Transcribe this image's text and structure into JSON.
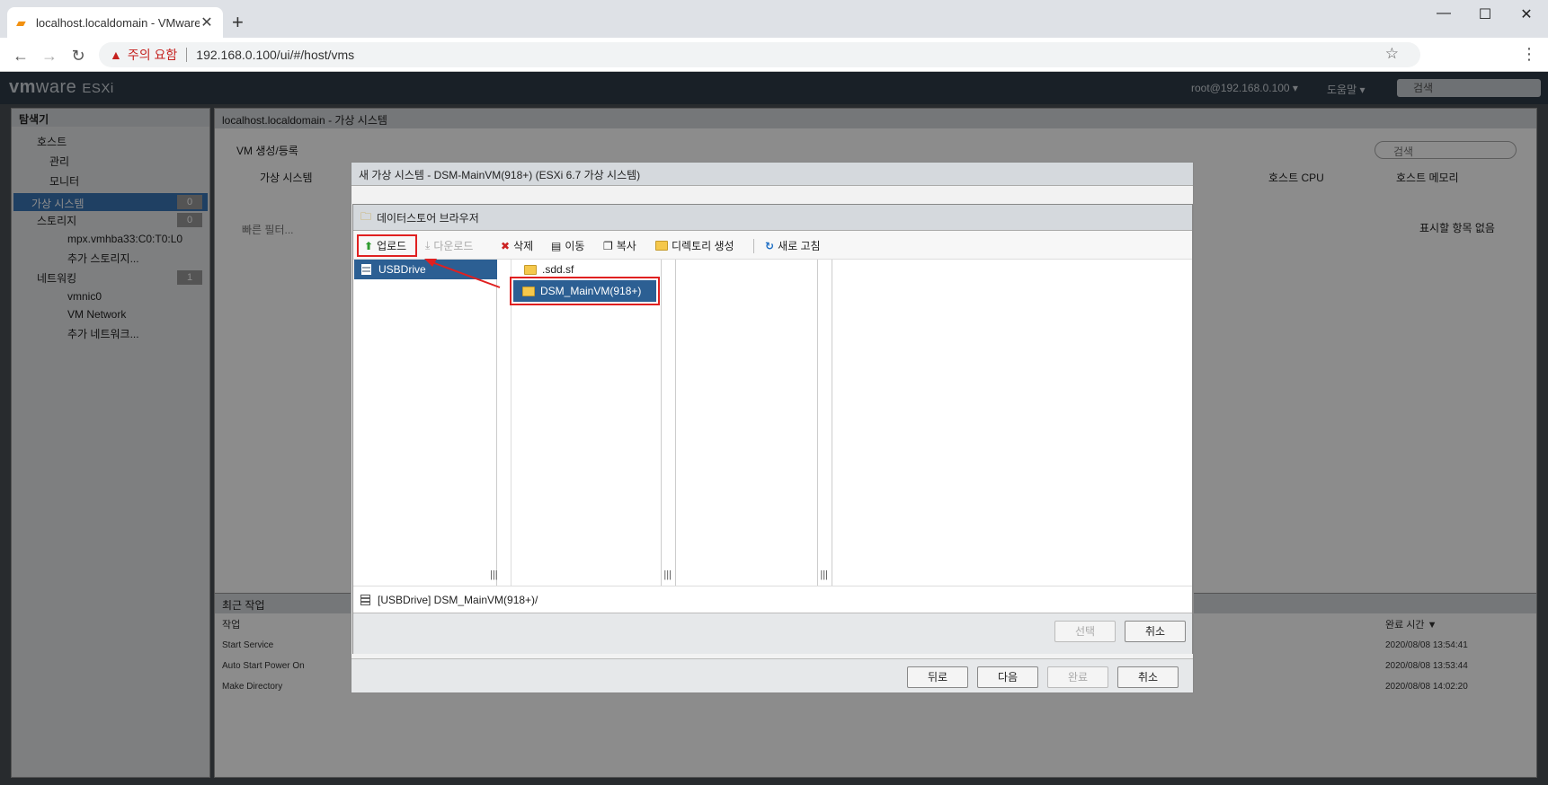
{
  "browser": {
    "tab_title": "localhost.localdomain - VMware",
    "new_tab": "+",
    "warning_label": "주의 요함",
    "url": "192.168.0.100/ui/#/host/vms"
  },
  "esxi": {
    "logo_vm": "vm",
    "logo_ware": "ware",
    "logo_product": "ESXi",
    "user": "root@192.168.0.100 ▾",
    "help": "도움말 ▾",
    "search_placeholder": "검색",
    "navigator": {
      "title": "탐색기",
      "host": "호스트",
      "manage": "관리",
      "monitor": "모니터",
      "vms": "가상 시스템",
      "vms_count": "0",
      "storage": "스토리지",
      "storage_count": "0",
      "storage_device": "mpx.vmhba33:C0:T0:L0",
      "more_storage": "추가 스토리지...",
      "networking": "네트워킹",
      "networking_count": "1",
      "vmnic": "vmnic0",
      "vm_network": "VM Network",
      "more_networks": "추가 네트워크..."
    },
    "main": {
      "title": "localhost.localdomain - 가상 시스템",
      "create_vm": "VM 생성/등록",
      "col_vm": "가상 시스템",
      "col_host_cpu": "호스트 CPU",
      "col_host_mem": "호스트 메모리",
      "quick_filter": "빠른 필터...",
      "search": "검색",
      "no_items": "표시할 항목 없음"
    },
    "tasks": {
      "title": "최근 작업",
      "col_task": "작업",
      "col_completed": "완료 시간 ▼",
      "rows": [
        {
          "task": "Start Service",
          "time": "2020/08/08 13:54:41"
        },
        {
          "task": "Auto Start Power On",
          "time": "2020/08/08 13:53:44"
        },
        {
          "task": "Make Directory",
          "time": "2020/08/08 14:02:20"
        }
      ]
    }
  },
  "wizard": {
    "title": "새 가상 시스템 - DSM-MainVM(918+) (ESXi 6.7 가상 시스템)",
    "back": "뒤로",
    "next": "다음",
    "finish": "완료",
    "cancel": "취소"
  },
  "browser_dialog": {
    "title": "데이터스토어 브라우저",
    "toolbar": {
      "upload": "업로드",
      "download": "다운로드",
      "delete": "삭제",
      "move": "이동",
      "copy": "복사",
      "mkdir": "디렉토리 생성",
      "refresh": "새로 고침"
    },
    "datastore": "USBDrive",
    "folders": [
      ".sdd.sf",
      "DSM_MainVM(918+)"
    ],
    "path": "[USBDrive] DSM_MainVM(918+)/",
    "select": "선택",
    "cancel": "취소"
  }
}
